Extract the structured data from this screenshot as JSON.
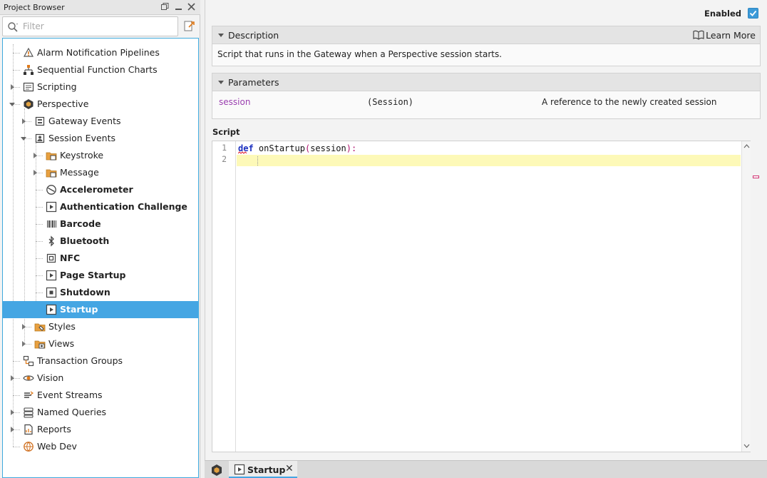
{
  "project_browser": {
    "title": "Project Browser",
    "filter_placeholder": "Filter",
    "tree": [
      {
        "label": "Alarm Notification Pipelines",
        "icon": "alarm-pipeline-icon",
        "level": 0,
        "expand": "none",
        "bold": false
      },
      {
        "label": "Sequential Function Charts",
        "icon": "sfc-icon",
        "level": 0,
        "expand": "none",
        "bold": false
      },
      {
        "label": "Scripting",
        "icon": "scripting-icon",
        "level": 0,
        "expand": "collapsed",
        "bold": false
      },
      {
        "label": "Perspective",
        "icon": "perspective-icon",
        "level": 0,
        "expand": "expanded",
        "bold": false
      },
      {
        "label": "Gateway Events",
        "icon": "gateway-events-icon",
        "level": 1,
        "expand": "collapsed",
        "bold": false
      },
      {
        "label": "Session Events",
        "icon": "session-events-icon",
        "level": 1,
        "expand": "expanded",
        "bold": false
      },
      {
        "label": "Keystroke",
        "icon": "folder-icon",
        "level": 2,
        "expand": "collapsed",
        "bold": false
      },
      {
        "label": "Message",
        "icon": "folder-icon",
        "level": 2,
        "expand": "collapsed",
        "bold": false
      },
      {
        "label": "Accelerometer",
        "icon": "accelerometer-icon",
        "level": 2,
        "expand": "none",
        "bold": true
      },
      {
        "label": "Authentication Challenge",
        "icon": "script-icon",
        "level": 2,
        "expand": "none",
        "bold": true
      },
      {
        "label": "Barcode",
        "icon": "barcode-icon",
        "level": 2,
        "expand": "none",
        "bold": true
      },
      {
        "label": "Bluetooth",
        "icon": "bluetooth-icon",
        "level": 2,
        "expand": "none",
        "bold": true
      },
      {
        "label": "NFC",
        "icon": "nfc-icon",
        "level": 2,
        "expand": "none",
        "bold": true
      },
      {
        "label": "Page Startup",
        "icon": "script-icon",
        "level": 2,
        "expand": "none",
        "bold": true
      },
      {
        "label": "Shutdown",
        "icon": "shutdown-icon",
        "level": 2,
        "expand": "none",
        "bold": true
      },
      {
        "label": "Startup",
        "icon": "script-icon",
        "level": 2,
        "expand": "none",
        "bold": true,
        "selected": true
      },
      {
        "label": "Styles",
        "icon": "styles-folder-icon",
        "level": 1,
        "expand": "collapsed",
        "bold": false
      },
      {
        "label": "Views",
        "icon": "views-folder-icon",
        "level": 1,
        "expand": "collapsed",
        "bold": false
      },
      {
        "label": "Transaction Groups",
        "icon": "transaction-groups-icon",
        "level": 0,
        "expand": "none",
        "bold": false
      },
      {
        "label": "Vision",
        "icon": "vision-icon",
        "level": 0,
        "expand": "collapsed",
        "bold": false
      },
      {
        "label": "Event Streams",
        "icon": "event-streams-icon",
        "level": 0,
        "expand": "none",
        "bold": false
      },
      {
        "label": "Named Queries",
        "icon": "named-queries-icon",
        "level": 0,
        "expand": "collapsed",
        "bold": false
      },
      {
        "label": "Reports",
        "icon": "reports-icon",
        "level": 0,
        "expand": "collapsed",
        "bold": false
      },
      {
        "label": "Web Dev",
        "icon": "web-dev-icon",
        "level": 0,
        "expand": "none",
        "bold": false
      }
    ]
  },
  "editor": {
    "enabled_label": "Enabled",
    "enabled": true,
    "description": {
      "header": "Description",
      "learn_more": "Learn More",
      "text": "Script that runs in the Gateway when a Perspective session starts."
    },
    "parameters": {
      "header": "Parameters",
      "items": [
        {
          "name": "session",
          "type": "(Session)",
          "description": "A reference to the newly created session"
        }
      ]
    },
    "script_label": "Script",
    "code": {
      "line_numbers": [
        "1",
        "2"
      ],
      "keyword": "def",
      "function_name": "onStartup",
      "open_paren": "(",
      "param": "session",
      "close": "):",
      "current_line": 2
    }
  },
  "tabs": [
    {
      "label": "Startup",
      "active": true
    }
  ],
  "colors": {
    "selection": "#45a6e3",
    "param_name": "#9b3fb0",
    "keyword": "#1a2fbf",
    "current_line": "#fdf9b8"
  }
}
